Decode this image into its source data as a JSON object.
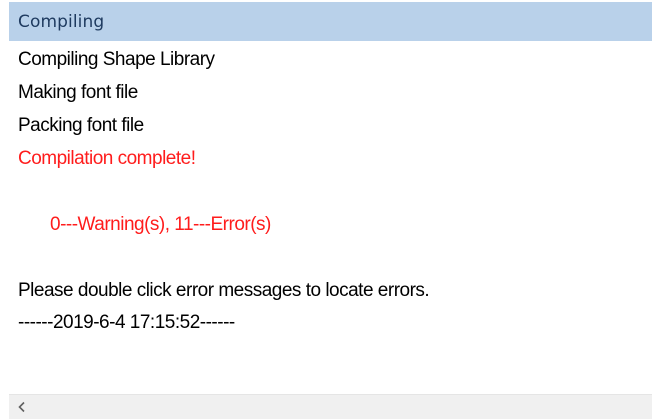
{
  "header": {
    "title": "Compiling"
  },
  "output": {
    "lines": [
      "Compiling Shape Library",
      "Making font file",
      "Packing font file",
      "Compilation complete!",
      "",
      "0---Warning(s), 11---Error(s)",
      "",
      "Please double click error messages to locate errors.",
      "------2019-6-4 17:15:52------"
    ]
  },
  "colors": {
    "header_bg": "#b9d1ea",
    "header_text": "#1e3a5f",
    "error_text": "#ff1c1c",
    "normal_text": "#000000",
    "scrollbar_bg": "#f0f0f0"
  },
  "scrollbar": {
    "left_icon": "chevron-left-icon"
  }
}
